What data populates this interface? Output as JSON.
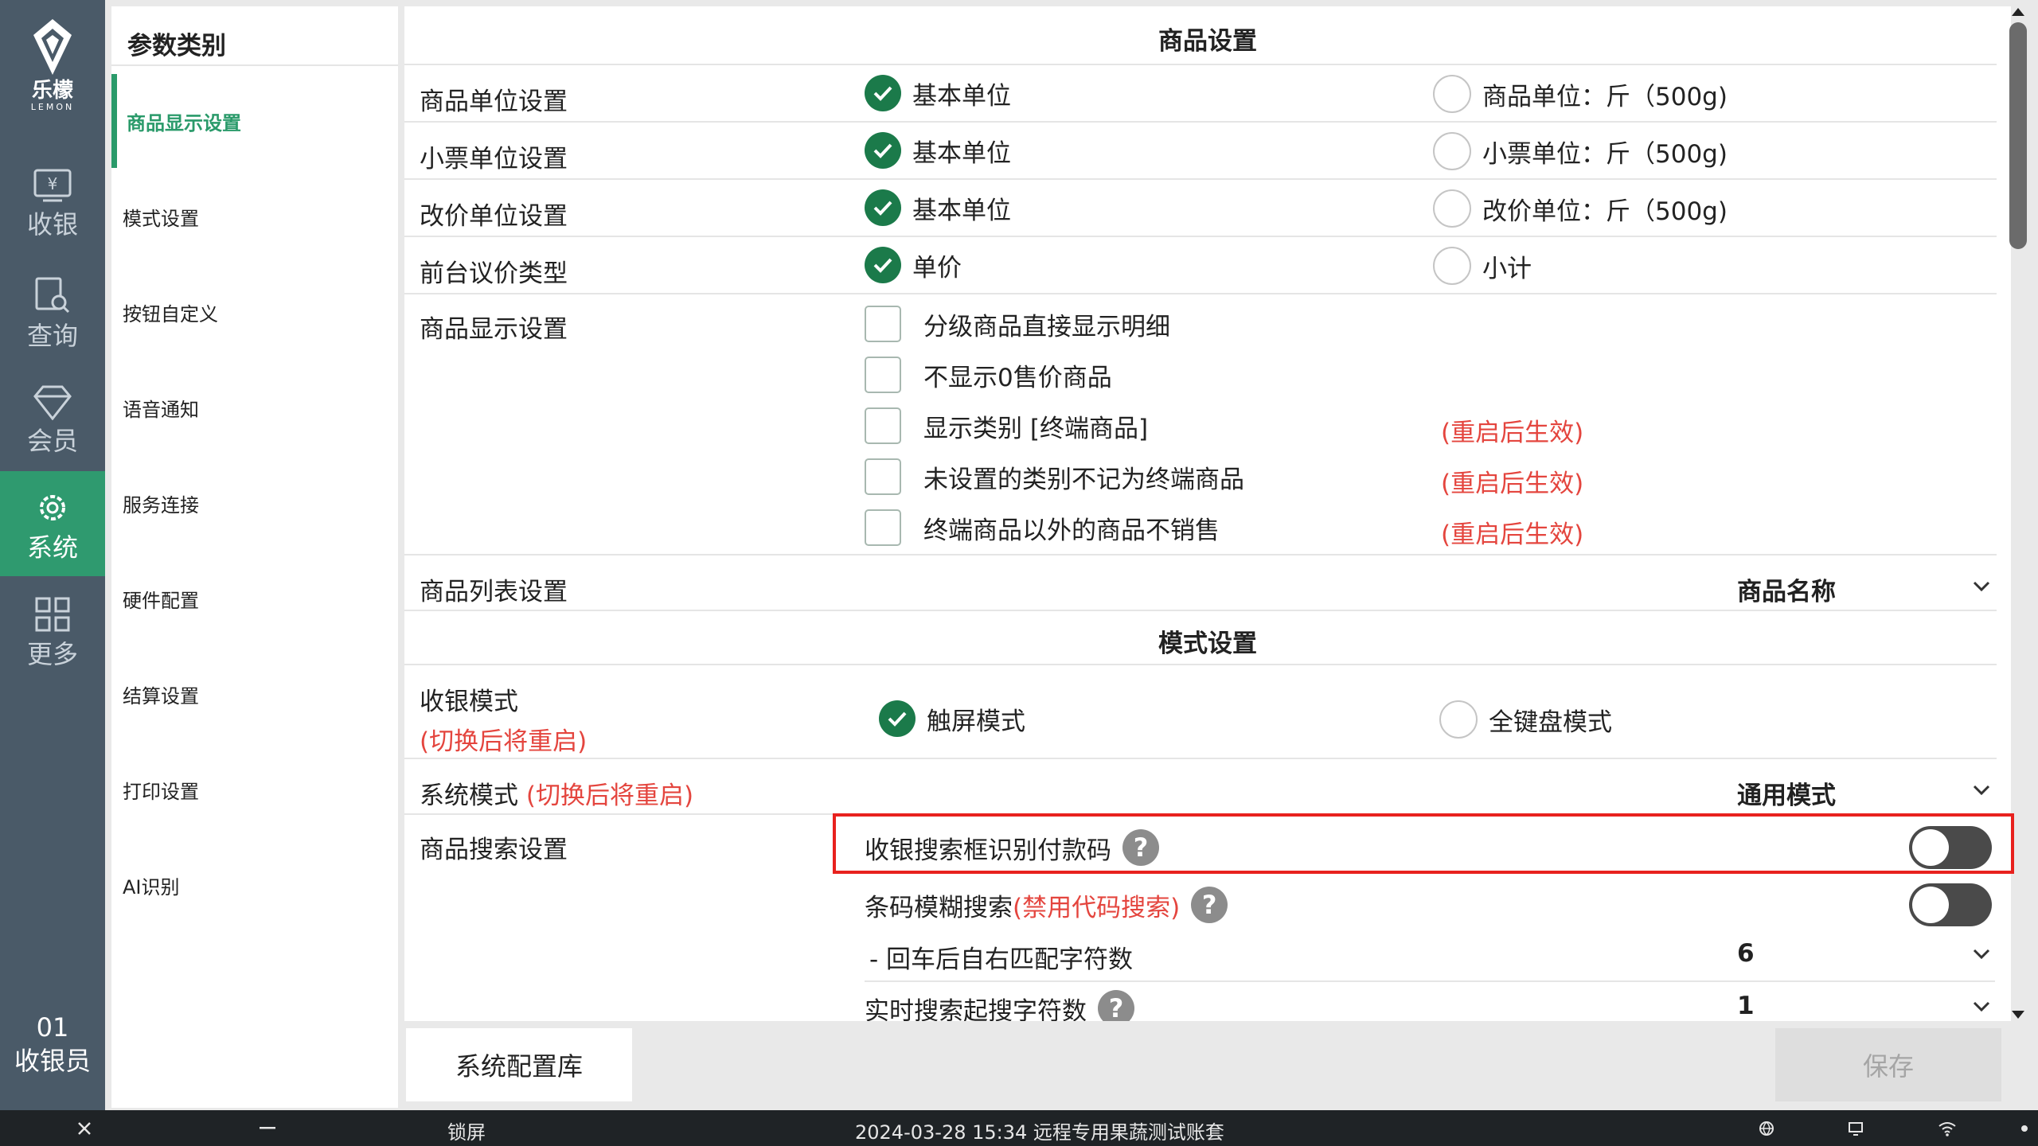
{
  "brand": {
    "zh": "乐檬",
    "en": "LEMON"
  },
  "nav": {
    "items": [
      {
        "label": "收银",
        "icon": "cashier-icon"
      },
      {
        "label": "查询",
        "icon": "search-doc-icon"
      },
      {
        "label": "会员",
        "icon": "diamond-icon"
      },
      {
        "label": "系统",
        "icon": "gear-icon"
      },
      {
        "label": "更多",
        "icon": "grid-icon"
      }
    ],
    "active": "系统"
  },
  "user": {
    "id": "01",
    "role": "收银员"
  },
  "category": {
    "title": "参数类别",
    "items": [
      "商品显示设置",
      "模式设置",
      "按钮自定义",
      "语音通知",
      "服务连接",
      "硬件配置",
      "结算设置",
      "打印设置",
      "AI识别"
    ],
    "active": "商品显示设置"
  },
  "goods": {
    "title": "商品设置",
    "unit_rows": [
      {
        "label": "商品单位设置",
        "opt1": "基本单位",
        "opt2": "商品单位：斤（500g)"
      },
      {
        "label": "小票单位设置",
        "opt1": "基本单位",
        "opt2": "小票单位：斤（500g)"
      },
      {
        "label": "改价单位设置",
        "opt1": "基本单位",
        "opt2": "改价单位：斤（500g)"
      },
      {
        "label": "前台议价类型",
        "opt1": "单价",
        "opt2": "小计"
      }
    ],
    "display_label": "商品显示设置",
    "display_opts": [
      {
        "text": "分级商品直接显示明细",
        "note": ""
      },
      {
        "text": "不显示0售价商品",
        "note": ""
      },
      {
        "text": "显示类别 [终端商品]",
        "note": "(重启后生效)"
      },
      {
        "text": "未设置的类别不记为终端商品",
        "note": "(重启后生效)"
      },
      {
        "text": "终端商品以外的商品不销售",
        "note": "(重启后生效)"
      }
    ],
    "list_label": "商品列表设置",
    "list_value": "商品名称"
  },
  "mode": {
    "title": "模式设置",
    "cashier_label": "收银模式",
    "cashier_note": "(切换后将重启)",
    "cashier_opt1": "触屏模式",
    "cashier_opt2": "全键盘模式",
    "system_label": "系统模式",
    "system_note": "(切换后将重启)",
    "system_value": "通用模式",
    "search_label": "商品搜索设置",
    "search_rows": {
      "paycode": "收银搜索框识别付款码",
      "fuzzy": "条码模糊搜索",
      "fuzzy_note": "(禁用代码搜索)",
      "match_label": "- 回车后自右匹配字符数",
      "match_value": "6",
      "realtime_label": "实时搜索起搜字符数",
      "realtime_value": "1"
    }
  },
  "bottom": {
    "lib_button": "系统配置库",
    "save_button": "保存"
  },
  "taskbar": {
    "lock": "锁屏",
    "status": "2024-03-28 15:34 远程专用果蔬测试账套"
  }
}
